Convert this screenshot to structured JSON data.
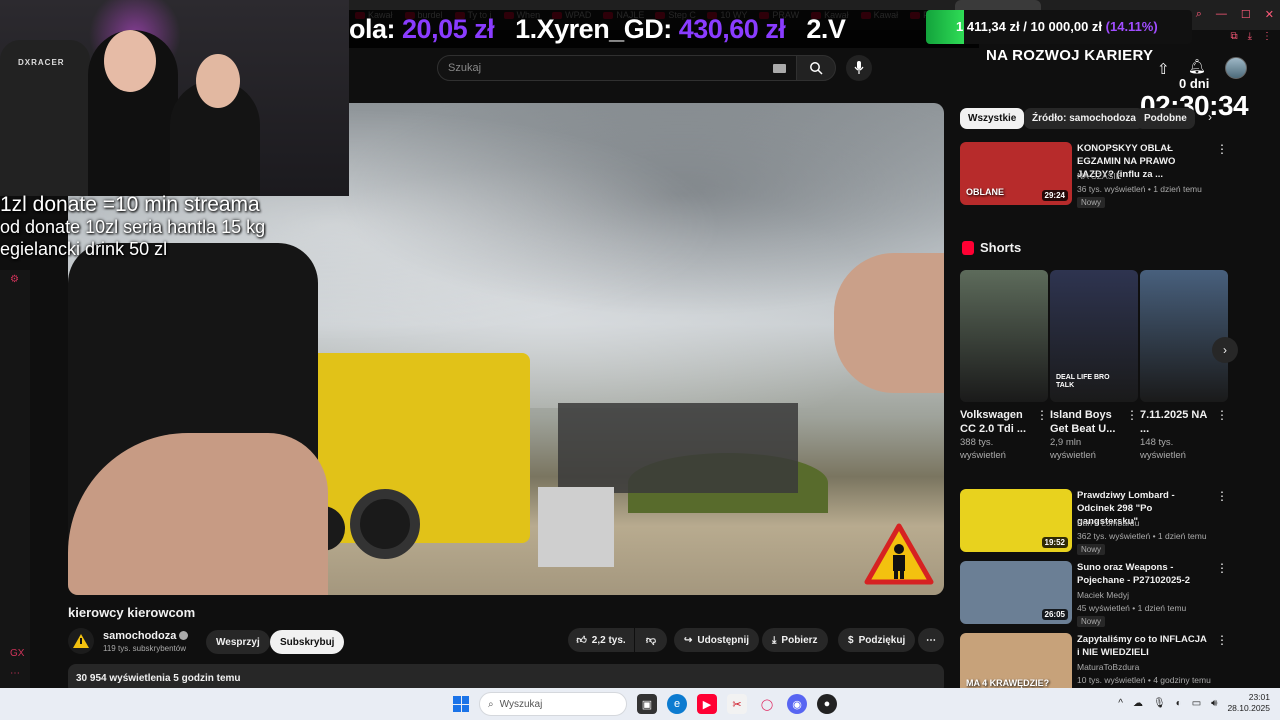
{
  "browser": {
    "tabs": [
      "Kawał",
      "burdel",
      "Ty to j",
      "When",
      "WPAD",
      "NAJLE",
      "Step C",
      "10 WY",
      "PRAW",
      "Kawał",
      "Kawał",
      "Ponad"
    ],
    "active_tab": "kierowcy kie",
    "tabs_after": [
      "samoc",
      "tulipan"
    ],
    "new_tab": "+"
  },
  "ticker": {
    "prefix": "ola:",
    "amount1": "20,05 zł",
    "entry2_name": "1.Xyren_GD:",
    "amount2": "430,60 zł",
    "entry3": "2.V"
  },
  "goal": {
    "current": "1 411,34 zł",
    "sep": " / ",
    "target": "10 000,00 zł",
    "pct": "(14.11%)",
    "progress": 0.1411
  },
  "header": {
    "search_placeholder": "Szukaj"
  },
  "overlay": {
    "line1": "1zl donate =10 min streama",
    "line2": "od donate 10zl seria hantla 15 kg",
    "line3": "egielancki drink 50 zl",
    "cam_brand": "DXRACER",
    "career_title": "NA ROZWOJ KARIERY",
    "days": "0 dni",
    "timer": "02:30:34"
  },
  "video": {
    "title": "kierowcy kierowcom",
    "channel": "samochodoza",
    "subs": "119 tys. subskrybentów",
    "support": "Wesprzyj",
    "subscribe": "Subskrybuj",
    "likes": "2,2 tys.",
    "share": "Udostępnij",
    "download": "Pobierz",
    "thanks": "Podziękuj",
    "more": "⋯",
    "views": "30 954 wyświetlenia  5 godzin temu"
  },
  "chips": [
    "Wszystkie",
    "Źródło: samochodoza",
    "Podobne"
  ],
  "recommendations": [
    {
      "title": "KONOPSKYY OBLAŁ EGZAMIN NA PRAWO JAZDY? (influ za ...",
      "channel": "NA CZASIE",
      "meta": "36 tys. wyświetleń • 1 dzień temu",
      "badge": "Nowy",
      "duration": "29:24",
      "thumb_color": "#b72b2b",
      "thumb_text": "OBLANE"
    },
    {
      "title": "Prawdziwy Lombard - Odcinek 298 \"Po gangstersku\"",
      "channel": "Pan z Lombardu",
      "meta": "362 tys. wyświetleń • 1 dzień temu",
      "badge": "Nowy",
      "duration": "19:52",
      "thumb_color": "#e8d21e",
      "thumb_text": ""
    },
    {
      "title": "Suno oraz Weapons - Pojechane - P27102025-2",
      "channel": "Maciek Medyj",
      "meta": "45 wyświetleń • 1 dzień temu",
      "badge": "Nowy",
      "duration": "26:05",
      "thumb_color": "#6b7f95",
      "thumb_text": ""
    },
    {
      "title": "Zapytaliśmy co to INFLACJA i NIE WIEDZIELI",
      "channel": "MaturaToBzdura",
      "meta": "10 tys. wyświetleń • 4 godziny temu",
      "badge": "",
      "duration": "",
      "thumb_color": "#c7a27a",
      "thumb_text": "MA 4 KRAWĘDZIE?"
    }
  ],
  "shorts": {
    "heading": "Shorts",
    "items": [
      {
        "title": "Volkswagen CC 2.0 Tdi ...",
        "views": "388 tys. wyświetleń",
        "color": "#5d6b5b"
      },
      {
        "title": "Island Boys Get Beat U...",
        "views": "2,9 mln wyświetleń",
        "color": "#2e3450",
        "overlay_text": "DEAL LIFE BRO TALK"
      },
      {
        "title": "7.11.2025 NA ...",
        "views": "148 tys. wyświetleń",
        "color": "#48607d"
      }
    ]
  },
  "taskbar": {
    "search": "Wyszukaj",
    "time": "23:01",
    "date": "28.10.2025"
  }
}
